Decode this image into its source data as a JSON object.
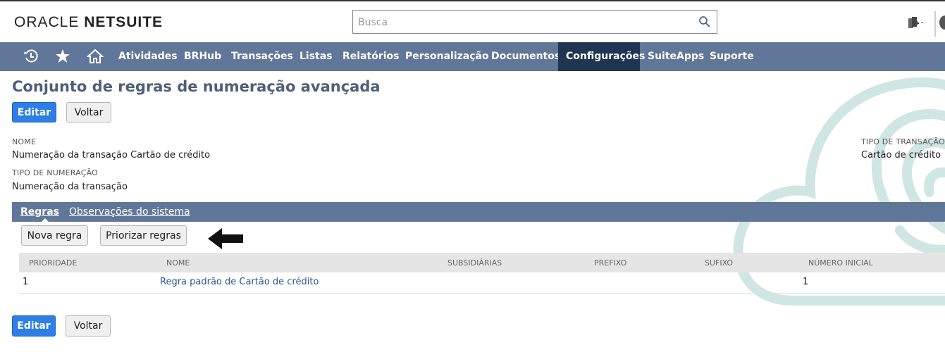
{
  "header": {
    "logo_part1": "ORACLE ",
    "logo_part2": "NETSUITE",
    "search_placeholder": "Busca"
  },
  "nav": {
    "items": [
      {
        "label": "Atividades"
      },
      {
        "label": "BRHub"
      },
      {
        "label": "Transações"
      },
      {
        "label": "Listas"
      },
      {
        "label": "Relatórios"
      },
      {
        "label": "Personalização"
      },
      {
        "label": "Documentos"
      },
      {
        "label": "Configurações",
        "active": true
      },
      {
        "label": "SuiteApps"
      },
      {
        "label": "Suporte"
      }
    ]
  },
  "page": {
    "title": "Conjunto de regras de numeração avançada",
    "edit_label": "Editar",
    "back_label": "Voltar"
  },
  "fields": {
    "name_label": "NOME",
    "name_value": "Numeração da transação Cartão de crédito",
    "numbering_type_label": "TIPO DE NUMERAÇÃO",
    "numbering_type_value": "Numeração da transação",
    "transaction_type_label": "TIPO DE TRANSAÇÃO",
    "transaction_type_value": "Cartão de crédito"
  },
  "tabs": {
    "rules_label": "Regras",
    "system_notes_label": "Observações do sistema"
  },
  "rules": {
    "new_rule_label": "Nova regra",
    "prioritize_label": "Priorizar regras",
    "columns": {
      "priority": "PRIORIDADE",
      "name": "NOME",
      "subsidiaries": "SUBSIDIÁRIAS",
      "prefix": "PREFIXO",
      "suffix": "SUFIXO",
      "initial_number": "NÚMERO INICIAL"
    },
    "rows": [
      {
        "priority": "1",
        "name": "Regra padrão de Cartão de crédito",
        "subsidiaries": "",
        "prefix": "",
        "suffix": "",
        "initial_number": "1"
      }
    ]
  },
  "colors": {
    "nav_bg": "#607799",
    "nav_active": "#1f3552",
    "primary_button": "#2f7ee6",
    "title": "#4d5f79",
    "watermark": "#cfe6e2"
  }
}
